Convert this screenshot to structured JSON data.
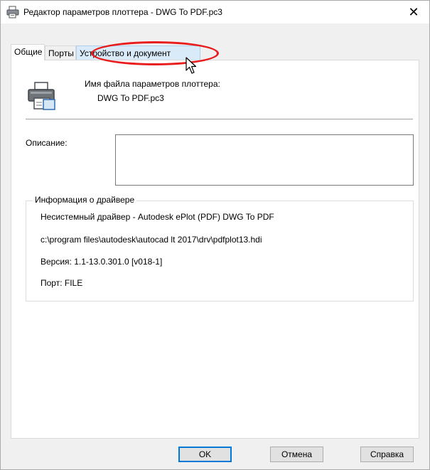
{
  "window": {
    "title": "Редактор параметров плоттера - DWG To PDF.pc3",
    "close_glyph": "✕",
    "icon": "plotter-icon"
  },
  "tabs": [
    {
      "label": "Общие",
      "active": true
    },
    {
      "label": "Порты",
      "active": false
    },
    {
      "label": "Устройство и документ",
      "active": false,
      "hovered": true
    }
  ],
  "general": {
    "filename_label": "Имя файла параметров плоттера:",
    "filename_value": "DWG To PDF.pc3",
    "description_label": "Описание:",
    "description_value": "",
    "driver_group_title": "Информация о драйвере",
    "driver_lines": [
      "Несистемный драйвер - Autodesk ePlot (PDF) DWG To PDF",
      "c:\\program files\\autodesk\\autocad lt 2017\\drv\\pdfplot13.hdi",
      "Версия: 1.1-13.0.301.0 [v018-1]",
      "Порт: FILE"
    ]
  },
  "buttons": {
    "ok": "OK",
    "cancel": "Отмена",
    "help": "Справка"
  },
  "annotation": {
    "highlight_color": "#e81c1c",
    "highlighted_element": "Устройство и документ"
  }
}
